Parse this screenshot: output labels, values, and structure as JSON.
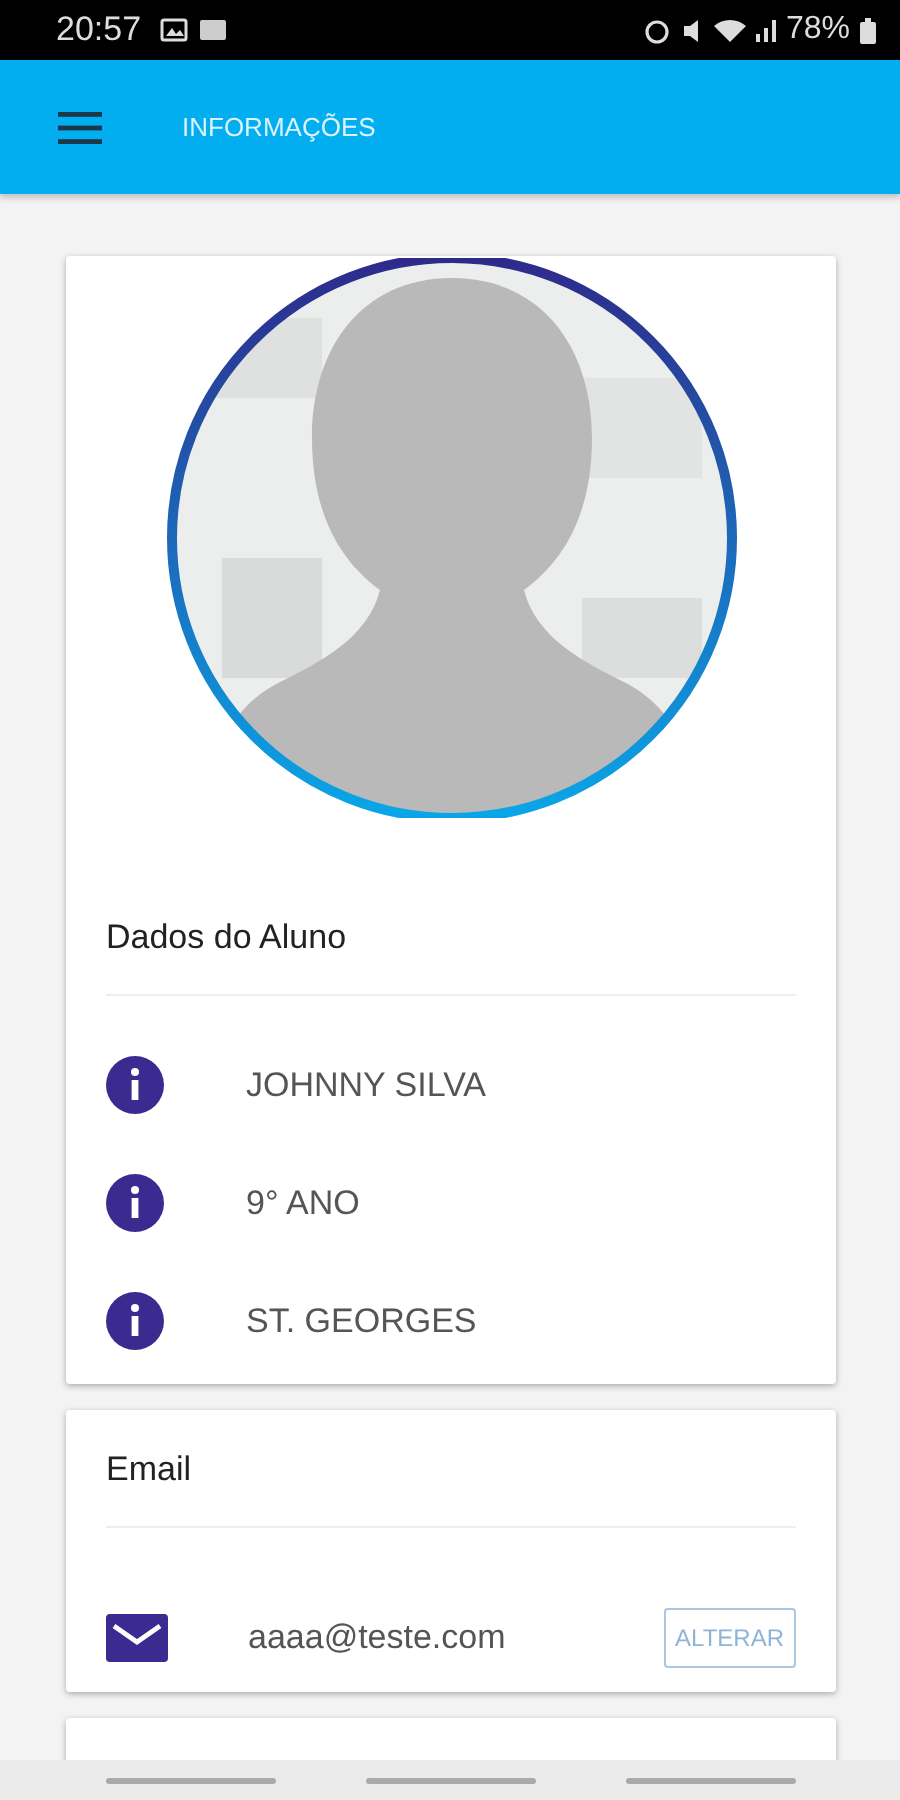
{
  "status_bar": {
    "time": "20:57",
    "battery": "78%"
  },
  "app_bar": {
    "title": "INFORMAÇÕES"
  },
  "student_card": {
    "title": "Dados do Aluno",
    "items": [
      {
        "text": "JOHNNY SILVA"
      },
      {
        "text": "9° ANO"
      },
      {
        "text": "ST. GEORGES"
      }
    ]
  },
  "email_card": {
    "title": "Email",
    "value": "aaaa@teste.com",
    "button": "ALTERAR"
  }
}
